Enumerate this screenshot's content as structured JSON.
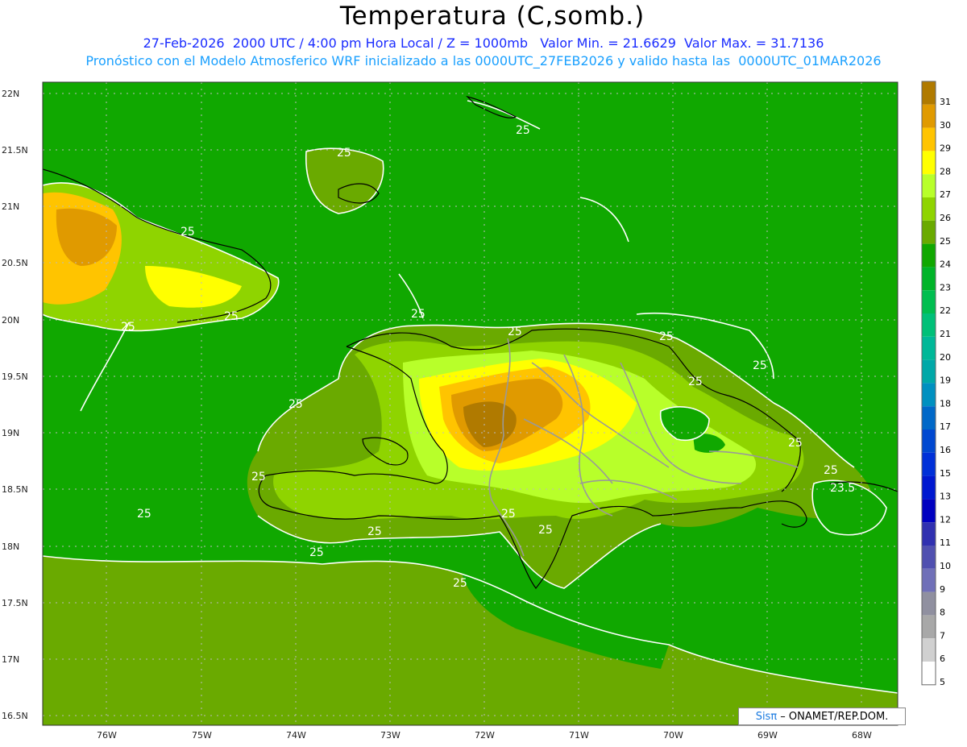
{
  "header": {
    "title": "Temperatura (C,somb.)",
    "line1": "27-Feb-2026  2000 UTC / 4:00 pm Hora Local / Z = 1000mb   Valor Min. = 21.6629  Valor Max. = 31.7136",
    "line2": "Pronóstico con el Modelo Atmosferico WRF inicializado a las 0000UTC_27FEB2026 y valido hasta las  0000UTC_01MAR2026"
  },
  "axes": {
    "lat_labels": [
      "22N",
      "21.5N",
      "21N",
      "20.5N",
      "20N",
      "19.5N",
      "19N",
      "18.5N",
      "18N",
      "17.5N",
      "17N",
      "16.5N"
    ],
    "lon_labels": [
      "76W",
      "75W",
      "74W",
      "73W",
      "72W",
      "71W",
      "70W",
      "69W",
      "68W"
    ]
  },
  "contour_labels": [
    "25",
    "25",
    "25",
    "25",
    "25",
    "25",
    "25",
    "25",
    "25",
    "25",
    "25",
    "25",
    "25",
    "25",
    "25",
    "25",
    "25",
    "25",
    "25",
    "25",
    "23.5"
  ],
  "legend": {
    "values": [
      "31",
      "30",
      "29",
      "28",
      "27",
      "26",
      "25",
      "24",
      "23",
      "22",
      "21",
      "20",
      "19",
      "18",
      "17",
      "16",
      "15",
      "13",
      "12",
      "11",
      "10",
      "9",
      "8",
      "7",
      "6",
      "5"
    ],
    "colors": [
      "#b07a00",
      "#e09a00",
      "#ffc400",
      "#ffff00",
      "#b8ff2a",
      "#8fd400",
      "#6aaa00",
      "#10a800",
      "#00b428",
      "#00be50",
      "#00c078",
      "#00b898",
      "#00a8a8",
      "#0090c0",
      "#0068c8",
      "#0048d0",
      "#0030d8",
      "#0018d0",
      "#0000c0",
      "#3030b0",
      "#5050b0",
      "#7070b8",
      "#9090a0",
      "#a8a8a8",
      "#d0d0d0",
      "#ffffff"
    ]
  },
  "credit": {
    "brand": "Sisπ",
    "text": " – ONAMET/REP.DOM."
  }
}
